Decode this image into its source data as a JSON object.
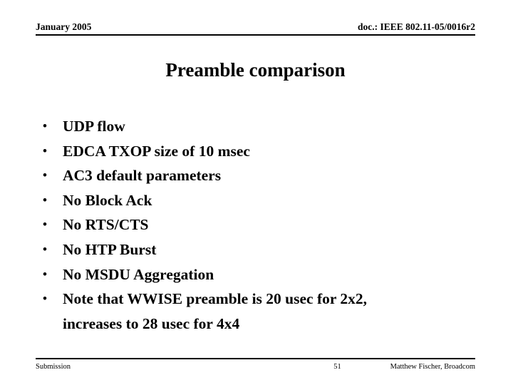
{
  "header": {
    "date": "January 2005",
    "doc": "doc.: IEEE 802.11-05/0016r2"
  },
  "title": "Preamble comparison",
  "bullets": {
    "marker": "•",
    "items": [
      {
        "text": "UDP flow"
      },
      {
        "text": "EDCA TXOP size of 10 msec"
      },
      {
        "text": "AC3 default parameters"
      },
      {
        "text": "No Block Ack"
      },
      {
        "text": "No RTS/CTS"
      },
      {
        "text": "No HTP Burst"
      },
      {
        "text": "No MSDU Aggregation"
      },
      {
        "text": "Note that WWISE preamble is 20 usec for 2x2,\nincreases to 28 usec for 4x4"
      }
    ]
  },
  "footer": {
    "left": "Submission",
    "page": "51",
    "right": "Matthew Fischer, Broadcom"
  },
  "colors": {
    "text": "#000000",
    "background": "#ffffff",
    "rule": "#000000"
  }
}
